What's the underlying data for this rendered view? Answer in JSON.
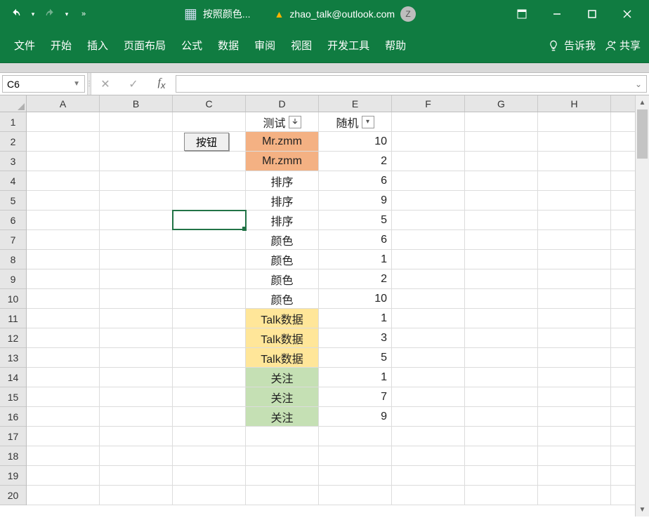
{
  "title": {
    "doc_name": "按照颜色...",
    "account": "zhao_talk@outlook.com",
    "avatar_initial": "Z"
  },
  "ribbon": {
    "tabs": [
      "文件",
      "开始",
      "插入",
      "页面布局",
      "公式",
      "数据",
      "审阅",
      "视图",
      "开发工具",
      "帮助"
    ],
    "tellme": "告诉我",
    "share": "共享"
  },
  "formula": {
    "name_box": "C6",
    "value": ""
  },
  "columns": [
    "A",
    "B",
    "C",
    "D",
    "E",
    "F",
    "G",
    "H"
  ],
  "row_numbers": [
    "1",
    "2",
    "3",
    "4",
    "5",
    "6",
    "7",
    "8",
    "9",
    "10",
    "11",
    "12",
    "13",
    "14",
    "15",
    "16",
    "17",
    "18",
    "19",
    "20"
  ],
  "button_label": "按钮",
  "headers": {
    "d": "测试",
    "e": "随机"
  },
  "chart_data": {
    "type": "table",
    "columns": [
      "测试",
      "随机"
    ],
    "rows": [
      {
        "d": "Mr.zmm",
        "e": 10,
        "fill": "orange"
      },
      {
        "d": "Mr.zmm",
        "e": 2,
        "fill": "orange"
      },
      {
        "d": "排序",
        "e": 6,
        "fill": ""
      },
      {
        "d": "排序",
        "e": 9,
        "fill": ""
      },
      {
        "d": "排序",
        "e": 5,
        "fill": ""
      },
      {
        "d": "颜色",
        "e": 6,
        "fill": ""
      },
      {
        "d": "颜色",
        "e": 1,
        "fill": ""
      },
      {
        "d": "颜色",
        "e": 2,
        "fill": ""
      },
      {
        "d": "颜色",
        "e": 10,
        "fill": ""
      },
      {
        "d": "Talk数据",
        "e": 1,
        "fill": "yellow"
      },
      {
        "d": "Talk数据",
        "e": 3,
        "fill": "yellow"
      },
      {
        "d": "Talk数据",
        "e": 5,
        "fill": "yellow"
      },
      {
        "d": "关注",
        "e": 1,
        "fill": "green"
      },
      {
        "d": "关注",
        "e": 7,
        "fill": "green"
      },
      {
        "d": "关注",
        "e": 9,
        "fill": "green"
      }
    ]
  },
  "selected_cell": {
    "row": 6,
    "col": "C"
  }
}
